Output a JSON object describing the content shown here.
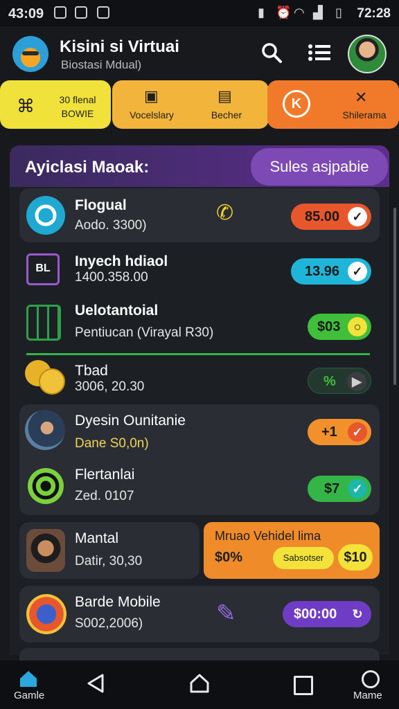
{
  "status_bar": {
    "time": "43:09",
    "right_time": "72:28"
  },
  "header": {
    "title": "Kisini si Virtuai",
    "subtitle": "Biostasi Mdual)"
  },
  "categories": [
    {
      "line1": "30 flenal",
      "line2": "BOWIE"
    },
    {
      "label": "Vocelslary"
    },
    {
      "label": "Becher"
    },
    {
      "label": "Shilerama"
    }
  ],
  "manager": {
    "title": "Ayiclasi Maoak:",
    "sales_button": "Sules asjpabie"
  },
  "rows": [
    {
      "title": "Flogual",
      "subtitle": "Aodo. 3300)",
      "price": "85.00",
      "accent": "#e8572b"
    },
    {
      "title": "Inyech hdiaol",
      "subtitle": "1400.358.00",
      "price": "13.96",
      "accent": "#1fb5d9"
    },
    {
      "title": "Uelotantoial",
      "subtitle": "Pentiucan (Virayal R30)",
      "price": "$03",
      "accent": "#3fbf3a"
    },
    {
      "title": "Tbad",
      "subtitle": "3006, 20.30",
      "price": "",
      "accent": "#2f5a45"
    },
    {
      "title": "Dyesin Ounitanie",
      "subtitle": "Dane S0,0n)",
      "price": "+1",
      "accent": "#f2902c"
    },
    {
      "title": "Flertanlai",
      "subtitle": "Zed. 0107",
      "price": "$7",
      "accent": "#34b548"
    },
    {
      "title": "Mantal",
      "subtitle": "Datir, 30,30"
    },
    {
      "title": "Barde Mobile",
      "subtitle": "S002,2006)",
      "price": "$00:00",
      "accent": "#6f3cc6"
    }
  ],
  "promo": {
    "title": "Mruao Vehidel lima",
    "percent": "$0%",
    "button": "Sabsotser",
    "price": "$10"
  },
  "bottom_nav": {
    "left_label": "Gamle",
    "right_label": "Mame"
  }
}
